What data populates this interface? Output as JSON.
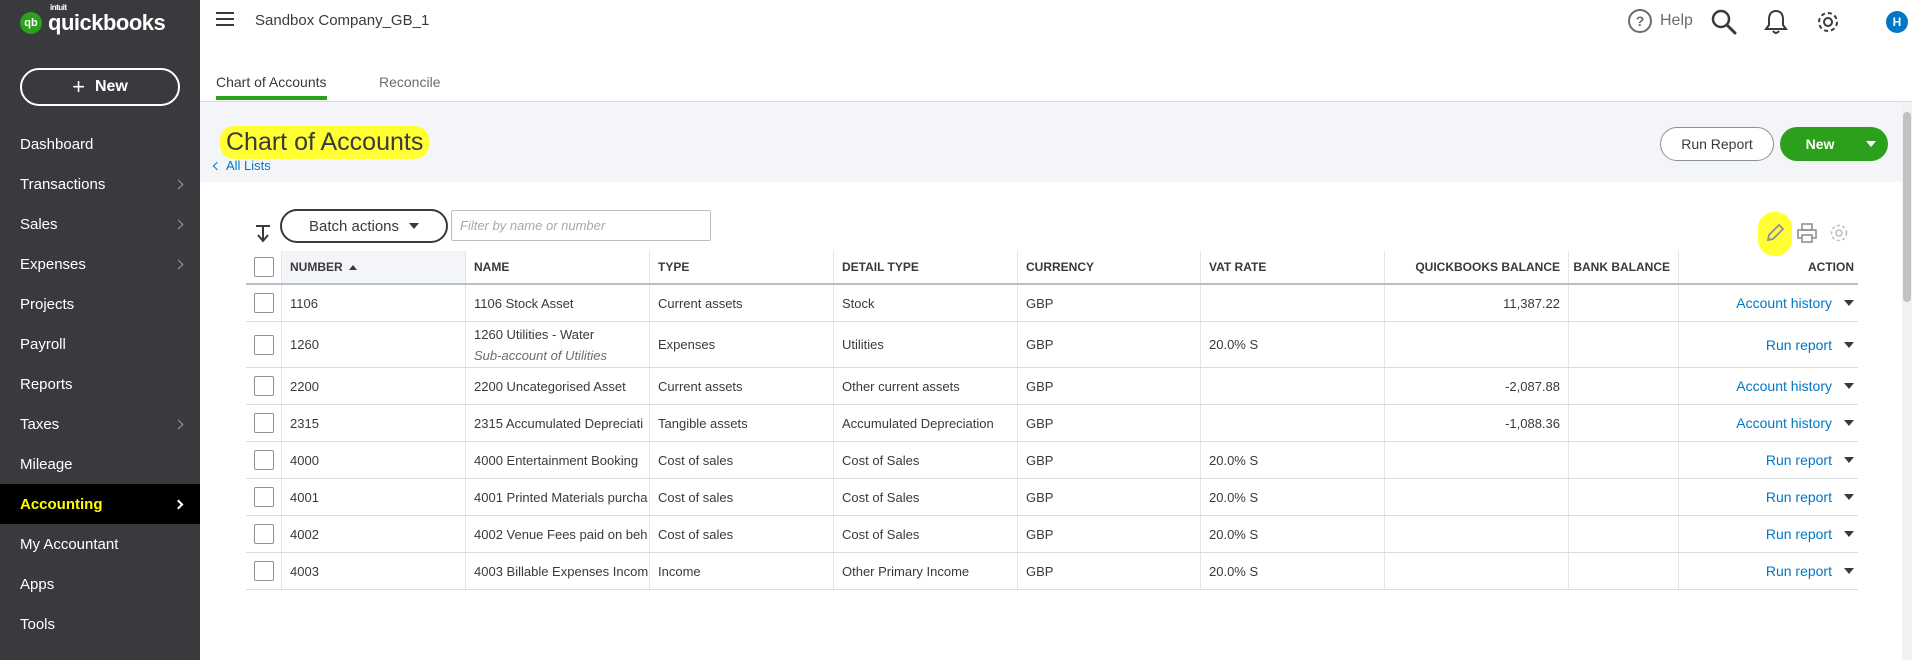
{
  "app": {
    "brand_small": "intuit",
    "brand_name": "quickbooks",
    "brand_mark": "qb",
    "company": "Sandbox Company_GB_1",
    "help_label": "Help",
    "avatar_initial": "H"
  },
  "sidebar": {
    "new_label": "New",
    "items": [
      {
        "label": "Dashboard",
        "chevron": false
      },
      {
        "label": "Transactions",
        "chevron": true
      },
      {
        "label": "Sales",
        "chevron": true
      },
      {
        "label": "Expenses",
        "chevron": true
      },
      {
        "label": "Projects",
        "chevron": false
      },
      {
        "label": "Payroll",
        "chevron": false
      },
      {
        "label": "Reports",
        "chevron": false
      },
      {
        "label": "Taxes",
        "chevron": true
      },
      {
        "label": "Mileage",
        "chevron": false
      },
      {
        "label": "Accounting",
        "chevron": true,
        "active": true
      },
      {
        "label": "My Accountant",
        "chevron": false
      },
      {
        "label": "Apps",
        "chevron": false
      },
      {
        "label": "Tools",
        "chevron": false
      }
    ]
  },
  "tabs": [
    {
      "label": "Chart of Accounts",
      "active": true
    },
    {
      "label": "Reconcile",
      "active": false
    }
  ],
  "page": {
    "title": "Chart of Accounts",
    "back_link": "All Lists",
    "run_report_label": "Run Report",
    "new_label": "New"
  },
  "toolbar": {
    "batch_actions_label": "Batch actions",
    "filter_placeholder": "Filter by name or number"
  },
  "table": {
    "columns": {
      "number": "NUMBER",
      "name": "NAME",
      "type": "TYPE",
      "detail_type": "DETAIL TYPE",
      "currency": "CURRENCY",
      "vat_rate": "VAT RATE",
      "qb_balance": "QUICKBOOKS BALANCE",
      "bank_balance": "BANK BALANCE",
      "action": "ACTION"
    },
    "rows": [
      {
        "number": "1106",
        "name": "1106 Stock Asset",
        "sub": "",
        "type": "Current assets",
        "detail": "Stock",
        "currency": "GBP",
        "vat": "",
        "qb": "11,387.22",
        "bank": "",
        "action": "Account history"
      },
      {
        "number": "1260",
        "name": "1260 Utilities - Water",
        "sub": "Sub-account of Utilities",
        "type": "Expenses",
        "detail": "Utilities",
        "currency": "GBP",
        "vat": "20.0% S",
        "qb": "",
        "bank": "",
        "action": "Run report"
      },
      {
        "number": "2200",
        "name": "2200 Uncategorised Asset",
        "sub": "",
        "type": "Current assets",
        "detail": "Other current assets",
        "currency": "GBP",
        "vat": "",
        "qb": "-2,087.88",
        "bank": "",
        "action": "Account history"
      },
      {
        "number": "2315",
        "name": "2315 Accumulated Depreciati",
        "sub": "",
        "type": "Tangible assets",
        "detail": "Accumulated Depreciation",
        "currency": "GBP",
        "vat": "",
        "qb": "-1,088.36",
        "bank": "",
        "action": "Account history"
      },
      {
        "number": "4000",
        "name": "4000 Entertainment Booking",
        "sub": "",
        "type": "Cost of sales",
        "detail": "Cost of Sales",
        "currency": "GBP",
        "vat": "20.0% S",
        "qb": "",
        "bank": "",
        "action": "Run report"
      },
      {
        "number": "4001",
        "name": "4001 Printed Materials purcha",
        "sub": "",
        "type": "Cost of sales",
        "detail": "Cost of Sales",
        "currency": "GBP",
        "vat": "20.0% S",
        "qb": "",
        "bank": "",
        "action": "Run report"
      },
      {
        "number": "4002",
        "name": "4002 Venue Fees paid on beh",
        "sub": "",
        "type": "Cost of sales",
        "detail": "Cost of Sales",
        "currency": "GBP",
        "vat": "20.0% S",
        "qb": "",
        "bank": "",
        "action": "Run report"
      },
      {
        "number": "4003",
        "name": "4003 Billable Expenses Incom",
        "sub": "",
        "type": "Income",
        "detail": "Other Primary Income",
        "currency": "GBP",
        "vat": "20.0% S",
        "qb": "",
        "bank": "",
        "action": "Run report"
      }
    ]
  },
  "colors": {
    "sidebar_bg": "#393a3d",
    "brand_green": "#2ca01c",
    "link_blue": "#0077c5",
    "highlight_yellow": "#ffff33",
    "active_nav_text": "#ffff00"
  },
  "icons": [
    "hamburger-icon",
    "help-icon",
    "search-icon",
    "bell-icon",
    "gear-icon",
    "collapse-arrow-icon",
    "edit-pencil-icon",
    "print-icon",
    "table-settings-icon"
  ]
}
